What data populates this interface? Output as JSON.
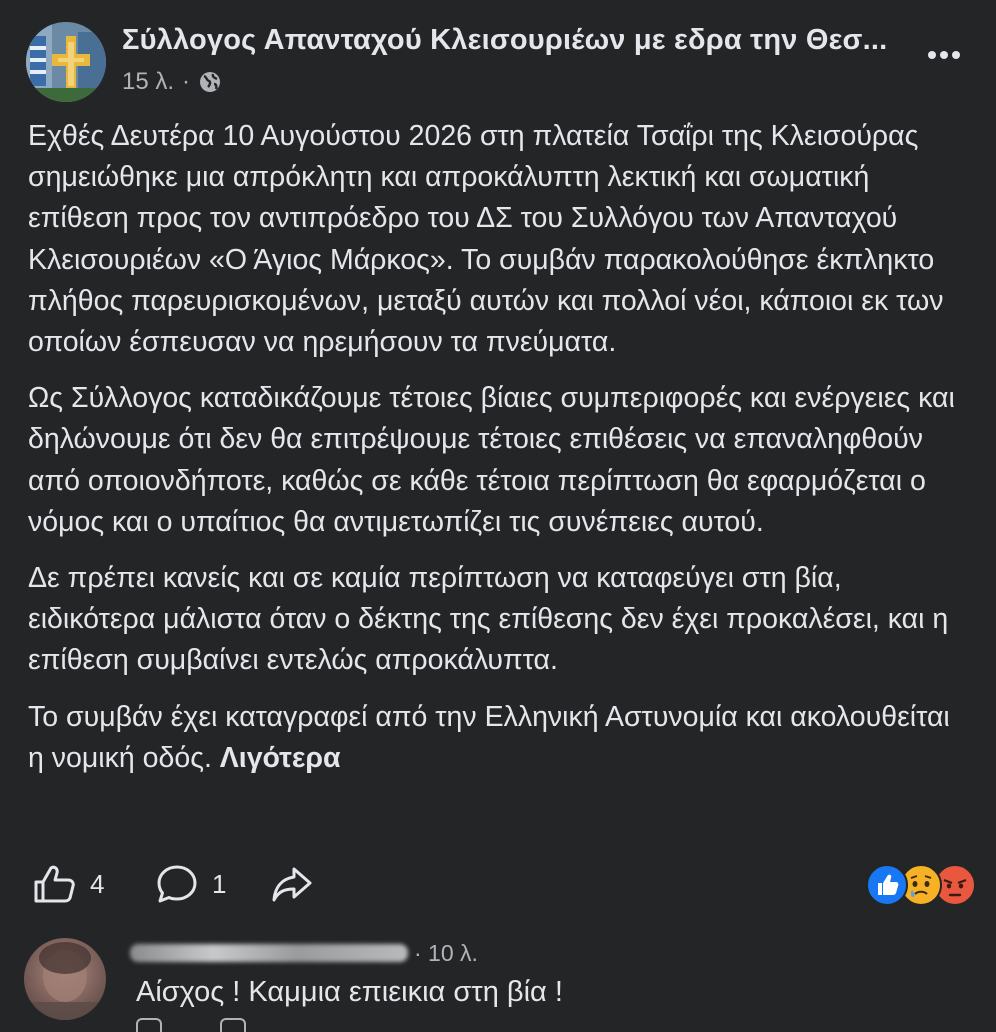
{
  "post": {
    "page_name": "Σύλλογος Απανταχού Κλεισουριέων με εδρα την Θεσ...",
    "time": "15 λ.",
    "separator": "·",
    "privacy_icon": "globe-icon",
    "more_icon": "more-options-icon",
    "paragraphs": [
      "Εχθές Δευτέρα 10 Αυγούστου 2026 στη πλατεία Τσαΐρι της Κλεισούρας σημειώθηκε μια απρόκλητη και απροκάλυπτη λεκτική και σωματική επίθεση προς τον αντιπρόεδρο του ΔΣ του Συλλόγου των Απανταχού Κλεισουριέων «Ο Άγιος Μάρκος». Το συμβάν παρακολούθησε έκπληκτο πλήθος παρευρισκομένων, μεταξύ αυτών και πολλοί νέοι, κάποιοι εκ των οποίων έσπευσαν να ηρεμήσουν τα πνεύματα.",
      "Ως Σύλλογος καταδικάζουμε τέτοιες βίαιες συμπεριφορές και ενέργειες και δηλώνουμε ότι δεν θα επιτρέψουμε τέτοιες επιθέσεις να επαναληφθούν από οποιονδήποτε, καθώς σε κάθε τέτοια περίπτωση θα εφαρμόζεται ο νόμος και ο υπαίτιος θα αντιμετωπίζει τις συνέπειες αυτού.",
      "Δε πρέπει κανείς και σε καμία περίπτωση να καταφεύγει στη βία, ειδικότερα μάλιστα όταν ο δέκτης της επίθεσης δεν έχει προκαλέσει, και η επίθεση συμβαίνει εντελώς απροκάλυπτα.",
      "Το συμβάν έχει καταγραφεί από την Ελληνική Αστυνομία και ακολουθείται η νομική οδός."
    ],
    "see_less": "Λιγότερα"
  },
  "actions": {
    "like_icon": "thumbs-up-icon",
    "like_count": "4",
    "comment_icon": "comment-bubble-icon",
    "comment_count": "1",
    "share_icon": "share-arrow-icon",
    "reaction_icons": [
      "like-reaction-icon",
      "sad-reaction-icon",
      "angry-reaction-icon"
    ]
  },
  "comment": {
    "time": "· 10 λ.",
    "text": "Αίσχος ! Καμμια επιεικια στη βία !"
  },
  "colors": {
    "background": "#242526",
    "text_primary": "#e4e6eb",
    "text_secondary": "#b0b3b8",
    "like_blue": "#1877f2",
    "angry_red": "#e9573f",
    "sad_yellow": "#f7b125"
  }
}
